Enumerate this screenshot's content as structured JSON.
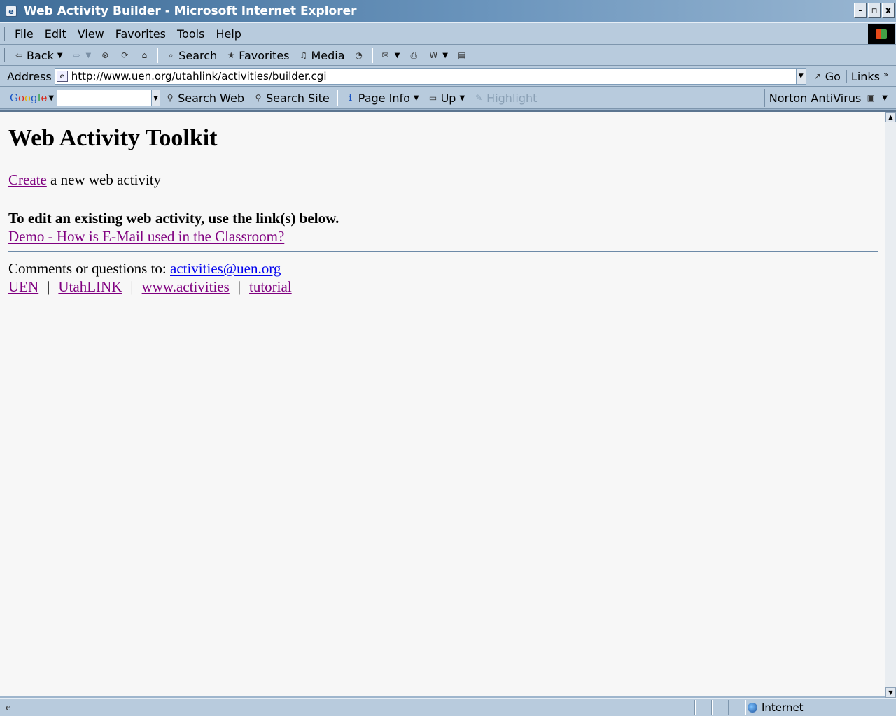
{
  "window": {
    "title": "Web Activity Builder - Microsoft Internet Explorer"
  },
  "window_controls": {
    "minimize": "-",
    "restore": "▫",
    "close": "x"
  },
  "menu": {
    "file": "File",
    "edit": "Edit",
    "view": "View",
    "favorites": "Favorites",
    "tools": "Tools",
    "help": "Help"
  },
  "toolbar": {
    "back": "Back",
    "search": "Search",
    "favorites": "Favorites",
    "media": "Media"
  },
  "address": {
    "label": "Address",
    "url": "http://www.uen.org/utahlink/activities/builder.cgi",
    "go": "Go",
    "links": "Links"
  },
  "googlebar": {
    "search_value": "",
    "search_web": "Search Web",
    "search_site": "Search Site",
    "page_info": "Page Info",
    "up": "Up",
    "highlight": "Highlight",
    "norton": "Norton AntiVirus"
  },
  "page": {
    "heading": "Web Activity Toolkit",
    "create_link": "Create",
    "create_text": " a new web activity",
    "edit_heading": "To edit an existing web activity, use the link(s) below.",
    "demo_link": "Demo - How is E-Mail used in the Classroom?",
    "comments_text": "Comments or questions to: ",
    "email_link": "activities@uen.org",
    "footer_links": [
      "UEN",
      "UtahLINK",
      "www.activities",
      "tutorial"
    ],
    "separator": "|"
  },
  "status": {
    "zone": "Internet"
  }
}
